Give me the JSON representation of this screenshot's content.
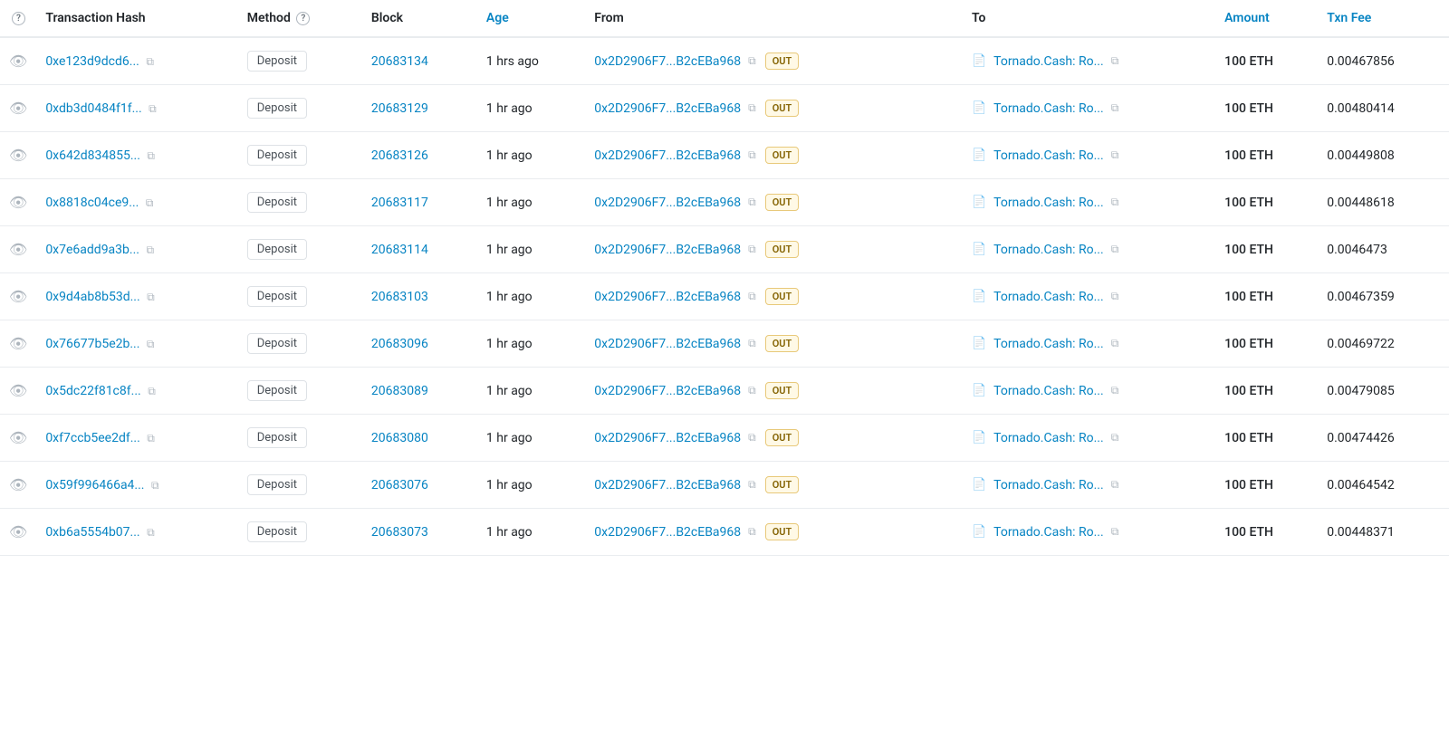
{
  "header": {
    "col_eye": "",
    "col_tx_hash": "Transaction Hash",
    "col_method": "Method",
    "col_block": "Block",
    "col_age": "Age",
    "col_from": "From",
    "col_to": "To",
    "col_amount": "Amount",
    "col_txn_fee": "Txn Fee"
  },
  "rows": [
    {
      "tx_hash": "0xe123d9dcd6...",
      "method": "Deposit",
      "block": "20683134",
      "age": "1 hrs ago",
      "from": "0x2D2906F7...B2cEBa968",
      "direction": "OUT",
      "to": "Tornado.Cash: Ro...",
      "amount": "100 ETH",
      "fee": "0.00467856"
    },
    {
      "tx_hash": "0xdb3d0484f1f...",
      "method": "Deposit",
      "block": "20683129",
      "age": "1 hr ago",
      "from": "0x2D2906F7...B2cEBa968",
      "direction": "OUT",
      "to": "Tornado.Cash: Ro...",
      "amount": "100 ETH",
      "fee": "0.00480414"
    },
    {
      "tx_hash": "0x642d834855...",
      "method": "Deposit",
      "block": "20683126",
      "age": "1 hr ago",
      "from": "0x2D2906F7...B2cEBa968",
      "direction": "OUT",
      "to": "Tornado.Cash: Ro...",
      "amount": "100 ETH",
      "fee": "0.00449808"
    },
    {
      "tx_hash": "0x8818c04ce9...",
      "method": "Deposit",
      "block": "20683117",
      "age": "1 hr ago",
      "from": "0x2D2906F7...B2cEBa968",
      "direction": "OUT",
      "to": "Tornado.Cash: Ro...",
      "amount": "100 ETH",
      "fee": "0.00448618"
    },
    {
      "tx_hash": "0x7e6add9a3b...",
      "method": "Deposit",
      "block": "20683114",
      "age": "1 hr ago",
      "from": "0x2D2906F7...B2cEBa968",
      "direction": "OUT",
      "to": "Tornado.Cash: Ro...",
      "amount": "100 ETH",
      "fee": "0.0046473"
    },
    {
      "tx_hash": "0x9d4ab8b53d...",
      "method": "Deposit",
      "block": "20683103",
      "age": "1 hr ago",
      "from": "0x2D2906F7...B2cEBa968",
      "direction": "OUT",
      "to": "Tornado.Cash: Ro...",
      "amount": "100 ETH",
      "fee": "0.00467359"
    },
    {
      "tx_hash": "0x76677b5e2b...",
      "method": "Deposit",
      "block": "20683096",
      "age": "1 hr ago",
      "from": "0x2D2906F7...B2cEBa968",
      "direction": "OUT",
      "to": "Tornado.Cash: Ro...",
      "amount": "100 ETH",
      "fee": "0.00469722"
    },
    {
      "tx_hash": "0x5dc22f81c8f...",
      "method": "Deposit",
      "block": "20683089",
      "age": "1 hr ago",
      "from": "0x2D2906F7...B2cEBa968",
      "direction": "OUT",
      "to": "Tornado.Cash: Ro...",
      "amount": "100 ETH",
      "fee": "0.00479085"
    },
    {
      "tx_hash": "0xf7ccb5ee2df...",
      "method": "Deposit",
      "block": "20683080",
      "age": "1 hr ago",
      "from": "0x2D2906F7...B2cEBa968",
      "direction": "OUT",
      "to": "Tornado.Cash: Ro...",
      "amount": "100 ETH",
      "fee": "0.00474426"
    },
    {
      "tx_hash": "0x59f996466a4...",
      "method": "Deposit",
      "block": "20683076",
      "age": "1 hr ago",
      "from": "0x2D2906F7...B2cEBa968",
      "direction": "OUT",
      "to": "Tornado.Cash: Ro...",
      "amount": "100 ETH",
      "fee": "0.00464542"
    },
    {
      "tx_hash": "0xb6a5554b07...",
      "method": "Deposit",
      "block": "20683073",
      "age": "1 hr ago",
      "from": "0x2D2906F7...B2cEBa968",
      "direction": "OUT",
      "to": "Tornado.Cash: Ro...",
      "amount": "100 ETH",
      "fee": "0.00448371"
    }
  ],
  "icons": {
    "eye": "👁",
    "copy": "⧉",
    "help": "?",
    "doc": "📄"
  }
}
